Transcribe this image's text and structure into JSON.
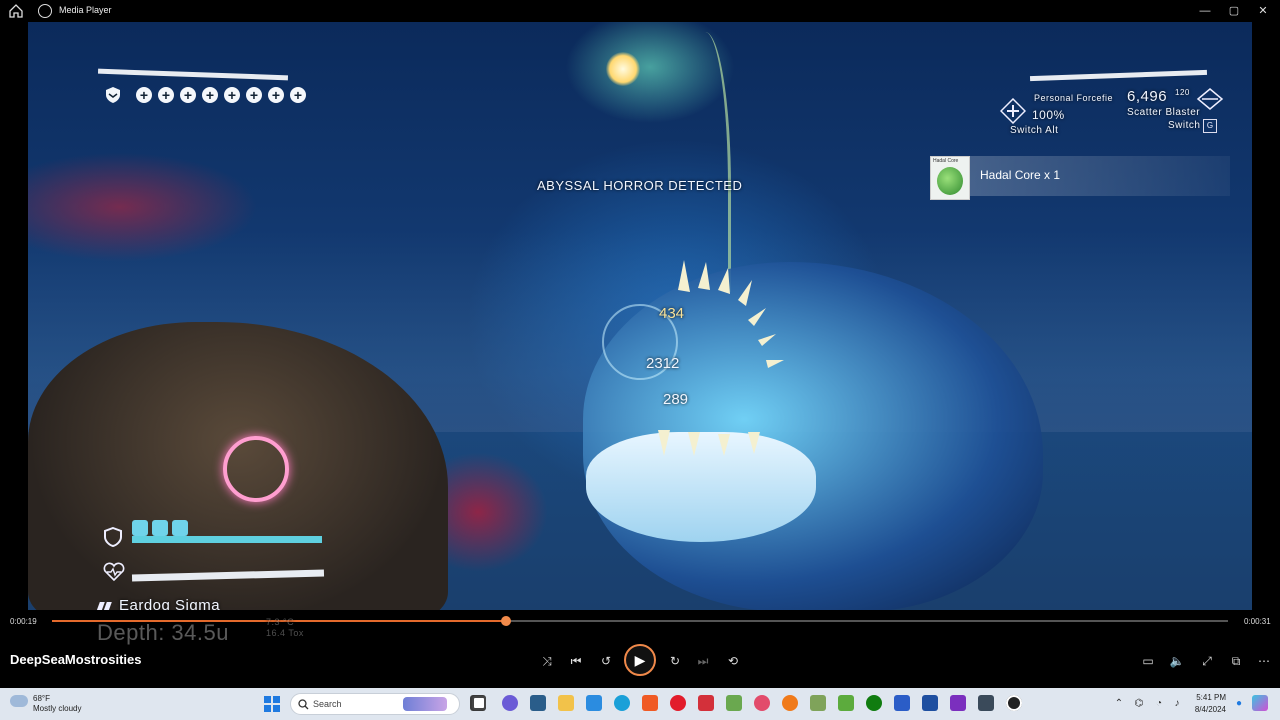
{
  "window": {
    "title": "Media Player",
    "controls": [
      "—",
      "▢",
      "✕"
    ]
  },
  "hud": {
    "alert": "ABYSSAL HORROR DETECTED",
    "damage_numbers": [
      "434",
      "2312",
      "289"
    ],
    "equipment": {
      "forcefield_label": "Personal Forcefie",
      "forcefield_pct": "100%",
      "switch_alt": "Switch Alt",
      "ammo": "6,496",
      "ammo_sub": "120",
      "weapon": "Scatter Blaster",
      "switch": "Switch",
      "switch_key": "G"
    },
    "loot": {
      "header": "Hadal Core",
      "label": "Hadal Core x 1"
    },
    "player": {
      "name": "Eardog Sigma",
      "depth": "Depth: 34.5u",
      "temp": "7.3 °C",
      "tox": "16.4 Tox"
    }
  },
  "player_controls": {
    "elapsed": "0:00:19",
    "total": "0:00:31",
    "progress": 0.386,
    "video_title": "DeepSeaMostrosities"
  },
  "taskbar": {
    "weather_temp": "68°F",
    "weather_desc": "Mostly cloudy",
    "search_placeholder": "Search",
    "time": "5:41 PM",
    "date": "8/4/2024"
  },
  "colors": {
    "accent": "#e46a2c",
    "hud_cyan": "#5fd0e0"
  }
}
